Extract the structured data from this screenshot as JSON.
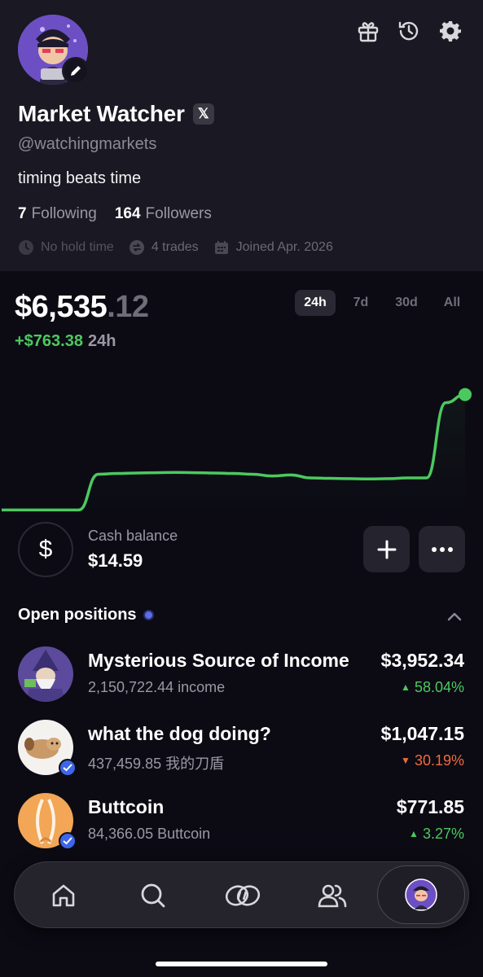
{
  "header": {
    "name": "Market Watcher",
    "x_badge": "𝕏",
    "handle": "@watchingmarkets",
    "bio": "timing beats time",
    "following_count": "7",
    "following_label": "Following",
    "followers_count": "164",
    "followers_label": "Followers",
    "meta": {
      "hold_time": "No hold time",
      "trades": "4 trades",
      "joined": "Joined Apr. 2026"
    }
  },
  "portfolio": {
    "balance_main": "$6,535",
    "balance_cents": ".12",
    "change_value": "+$763.38",
    "change_period": "24h",
    "ranges": [
      "24h",
      "7d",
      "30d",
      "All"
    ],
    "active_range": "24h",
    "accent_color": "#4cc95e"
  },
  "chart_data": {
    "type": "line",
    "title": "",
    "xlabel": "",
    "ylabel": "",
    "x": [
      0,
      1,
      2,
      3,
      4,
      5,
      6,
      7,
      8,
      9,
      10,
      11,
      12,
      13,
      14,
      15,
      16,
      17,
      18,
      19,
      20,
      21,
      22,
      23,
      24
    ],
    "series": [
      {
        "values": [
          5760,
          5760,
          5760,
          5760,
          5760,
          6000,
          6005,
          6008,
          6010,
          6012,
          6010,
          6008,
          6005,
          6000,
          5988,
          5995,
          5975,
          5972,
          5970,
          5968,
          5970,
          5975,
          5975,
          6480,
          6535
        ]
      }
    ],
    "grid": false,
    "legend": "none"
  },
  "cash": {
    "icon": "dollar-icon",
    "label": "Cash balance",
    "value": "$14.59",
    "add_label": "+",
    "more_label": "•••"
  },
  "positions": {
    "title": "Open positions",
    "items": [
      {
        "name": "Mysterious Source of Income",
        "amount": "2,150,722.44 income",
        "value": "$3,952.34",
        "pct": "58.04%",
        "direction": "up",
        "arrow": "▲"
      },
      {
        "name": "what the dog doing?",
        "amount": "437,459.85 我的刀盾",
        "value": "$1,047.15",
        "pct": "30.19%",
        "direction": "down",
        "arrow": "▼"
      },
      {
        "name": "Buttcoin",
        "amount": "84,366.05 Buttcoin",
        "value": "$771.85",
        "pct": "3.27%",
        "direction": "up",
        "arrow": "▲"
      }
    ]
  },
  "tabbar": {
    "tabs": [
      "home-icon",
      "search-icon",
      "coins-icon",
      "people-icon",
      "profile-avatar"
    ]
  }
}
